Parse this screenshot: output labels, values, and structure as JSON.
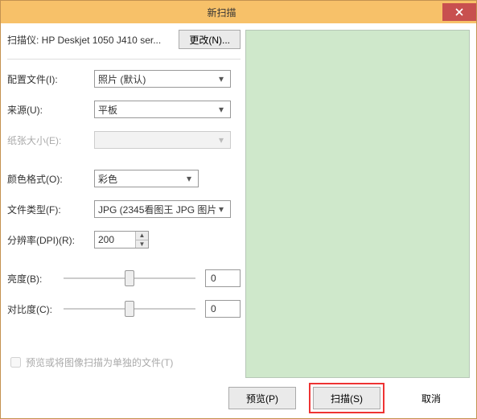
{
  "window": {
    "title": "新扫描"
  },
  "scanner": {
    "label": "扫描仪: HP Deskjet 1050 J410 ser...",
    "change_btn": "更改(N)..."
  },
  "form": {
    "profile": {
      "label": "配置文件(I):",
      "value": "照片 (默认)"
    },
    "source": {
      "label": "来源(U):",
      "value": "平板"
    },
    "paper": {
      "label": "纸张大小(E):",
      "value": ""
    },
    "color": {
      "label": "颜色格式(O):",
      "value": "彩色"
    },
    "filetype": {
      "label": "文件类型(F):",
      "value": "JPG (2345看图王 JPG 图片"
    },
    "dpi": {
      "label": "分辨率(DPI)(R):",
      "value": "200"
    },
    "brightness": {
      "label": "亮度(B):",
      "value": "0"
    },
    "contrast": {
      "label": "对比度(C):",
      "value": "0"
    },
    "separate_files": {
      "label": "预览或将图像扫描为单独的文件(T)"
    }
  },
  "footer": {
    "preview": "预览(P)",
    "scan": "扫描(S)",
    "cancel": "取消"
  }
}
